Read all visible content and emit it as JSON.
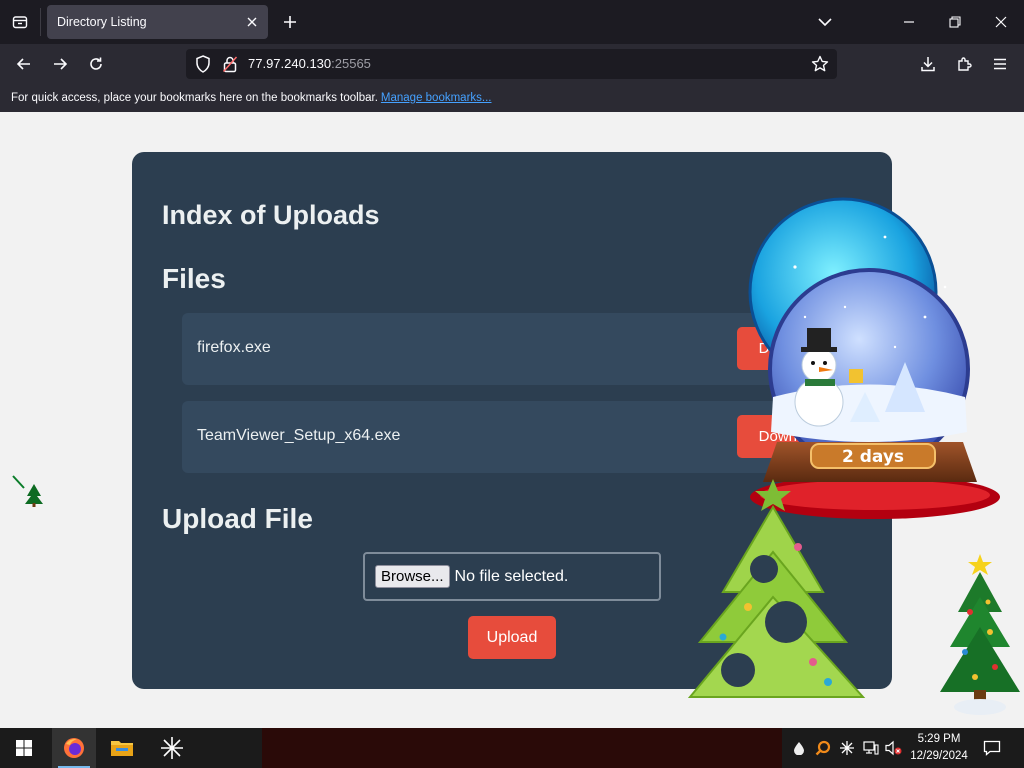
{
  "browser": {
    "tab": {
      "title": "Directory Listing"
    },
    "url": {
      "host": "77.97.240.130",
      "port": ":25565"
    },
    "bookmarks_bar": {
      "message": "For quick access, place your bookmarks here on the bookmarks toolbar.",
      "link": "Manage bookmarks..."
    }
  },
  "page": {
    "title": "Index of Uploads",
    "files_heading": "Files",
    "files": [
      {
        "name": "firefox.exe",
        "button": "Download"
      },
      {
        "name": "TeamViewer_Setup_x64.exe",
        "button": "Download"
      }
    ],
    "upload_heading": "Upload File",
    "browse_label": "Browse...",
    "no_file_label": "No file selected.",
    "upload_label": "Upload"
  },
  "decorations": {
    "globe_banner": "2 days"
  },
  "taskbar": {
    "time": "5:29 PM",
    "date": "12/29/2024"
  },
  "colors": {
    "card": "#2c3e50",
    "file_row": "#34495e",
    "accent_button": "#e74c3c",
    "heading_text": "#ecf0f1"
  }
}
